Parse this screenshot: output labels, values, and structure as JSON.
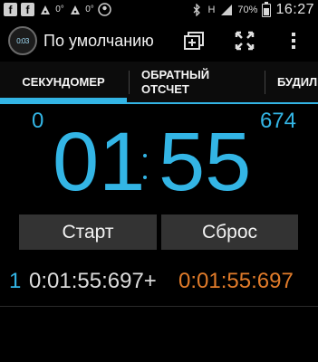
{
  "status_bar": {
    "left_icons": [
      "facebook-icon",
      "facebook-icon",
      "notification-icon",
      "temperature-icon",
      "notification-icon",
      "temperature-icon",
      "user-icon"
    ],
    "left_texts": [
      "f",
      "f",
      "",
      "0°",
      "",
      "0°",
      ""
    ],
    "battery": "70%",
    "battery_level": 0.7,
    "time": "16:27",
    "signal_text": "H"
  },
  "action_bar": {
    "title": "По умолчанию",
    "app_icon_text": "0:03"
  },
  "tabs": {
    "stopwatch": "СЕКУНДОМЕР",
    "countdown_line1": "ОБРАТНЫЙ",
    "countdown_line2": "ОТСЧЕТ",
    "alarm": "БУДИЛЬНИК"
  },
  "stopwatch": {
    "lap_count": "0",
    "milliseconds": "674",
    "minutes": "01",
    "seconds": "55"
  },
  "buttons": {
    "start": "Старт",
    "reset": "Сброс"
  },
  "laps": [
    {
      "number": "1",
      "total": "0:01:55:697+",
      "split": "0:01:55:697"
    }
  ],
  "colors": {
    "accent": "#33b5e5",
    "split": "#e07b2a"
  }
}
